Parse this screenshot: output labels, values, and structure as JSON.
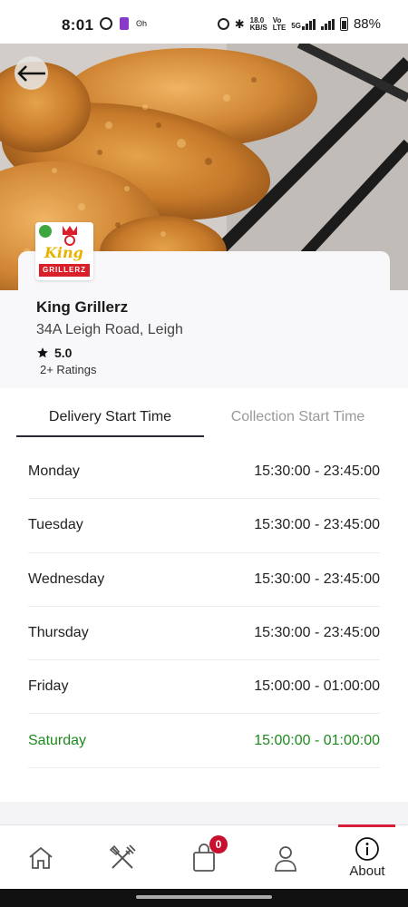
{
  "status_bar": {
    "time": "8:01",
    "network_speed_top": "18.0",
    "network_speed_bottom": "KB/S",
    "volte_top": "Vo",
    "volte_bottom": "LTE",
    "network_type": "5G",
    "battery": "88%",
    "app_label": "ʘh"
  },
  "hero": {
    "back_icon": "arrow-left-icon"
  },
  "store": {
    "logo_text_top": "King",
    "logo_text_bottom": "GRILLERZ",
    "name": "King Grillerz",
    "address": "34A Leigh Road, Leigh",
    "rating": "5.0",
    "rating_count": "2+ Ratings"
  },
  "tabs": [
    {
      "label": "Delivery Start Time",
      "active": true
    },
    {
      "label": "Collection Start Time",
      "active": false
    }
  ],
  "schedule": [
    {
      "day": "Monday",
      "hours": "15:30:00 - 23:45:00",
      "today": false
    },
    {
      "day": "Tuesday",
      "hours": "15:30:00 - 23:45:00",
      "today": false
    },
    {
      "day": "Wednesday",
      "hours": "15:30:00 - 23:45:00",
      "today": false
    },
    {
      "day": "Thursday",
      "hours": "15:30:00 - 23:45:00",
      "today": false
    },
    {
      "day": "Friday",
      "hours": "15:00:00 - 01:00:00",
      "today": false
    },
    {
      "day": "Saturday",
      "hours": "15:00:00 - 01:00:00",
      "today": true
    }
  ],
  "bottom_nav": {
    "items": [
      {
        "icon": "home-icon",
        "label": ""
      },
      {
        "icon": "fork-knife-icon",
        "label": ""
      },
      {
        "icon": "shopping-bag-icon",
        "label": "",
        "badge": "0"
      },
      {
        "icon": "user-icon",
        "label": ""
      },
      {
        "icon": "info-icon",
        "label": "About",
        "active": true
      }
    ]
  },
  "colors": {
    "accent_red": "#d81f3a",
    "today_green": "#1e8a1e",
    "badge_red": "#c8102e"
  }
}
